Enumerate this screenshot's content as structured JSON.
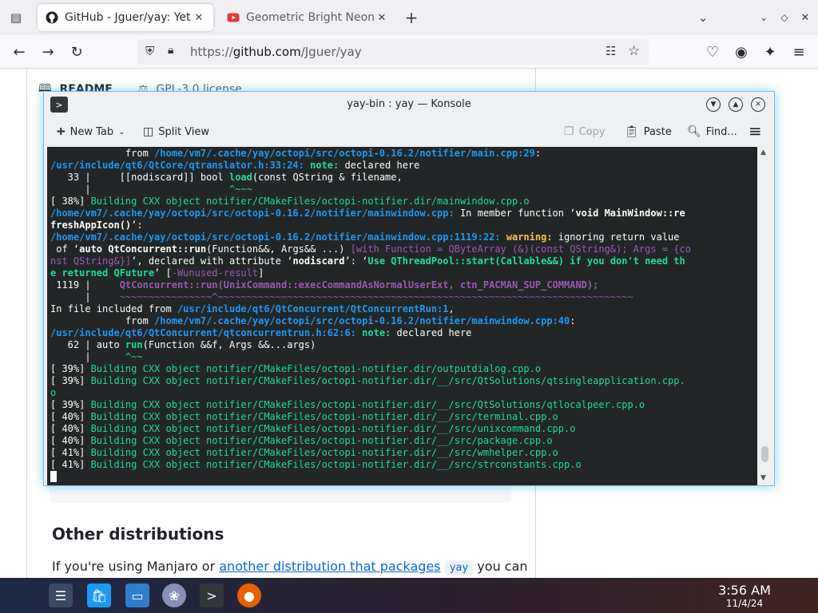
{
  "browser": {
    "tabs": [
      {
        "title": "GitHub - Jguer/yay: Yet an",
        "active": true
      },
      {
        "title": "Geometric Bright Neon Tr",
        "active": false
      }
    ],
    "url_scheme": "https://",
    "url_host": "github.com",
    "url_path": "/Jguer/yay"
  },
  "page": {
    "readme_tab": "README",
    "license_tab": "GPL-3.0 license",
    "heading": "Other distributions",
    "paragraph_start": "If you're using Manjaro or ",
    "paragraph_link": "another distribution that packages",
    "paragraph_code": "yay",
    "paragraph_end": " you can"
  },
  "konsole": {
    "title": "yay-bin : yay — Konsole",
    "toolbar": {
      "new_tab": "New Tab",
      "split_view": "Split View",
      "copy": "Copy",
      "paste": "Paste",
      "find": "Find..."
    },
    "scroll_position": 0.97,
    "scroll_visible_fraction": 0.05,
    "lines": [
      [
        [
          "",
          "             from "
        ],
        [
          "c-path",
          "/home/vm7/.cache/yay/octopi/src/octopi-0.16.2/notifier/main.cpp:29"
        ],
        [
          "",
          ":"
        ]
      ],
      [
        [
          "c-path",
          "/usr/include/qt6/QtCore/qtranslator.h:33:24: "
        ],
        [
          "c-gbold",
          "note:"
        ],
        [
          "",
          " declared here"
        ]
      ],
      [
        [
          "",
          "   33 |     [[nodiscard]] bool "
        ],
        [
          "c-gbold",
          "load"
        ],
        [
          "",
          "(const QString & filename,"
        ]
      ],
      [
        [
          "",
          "      |                        "
        ],
        [
          "c-green",
          "^~~~"
        ]
      ],
      [
        [
          "",
          "[ 38%] "
        ],
        [
          "c-green",
          "Building CXX object notifier/CMakeFiles/octopi-notifier.dir/mainwindow.cpp.o"
        ]
      ],
      [
        [
          "c-path",
          "/home/vm7/.cache/yay/octopi/src/octopi-0.16.2/notifier/mainwindow.cpp:"
        ],
        [
          "",
          " In member function ‘"
        ],
        [
          "c-bold",
          "void MainWindow::re"
        ]
      ],
      [
        [
          "c-bold",
          "freshAppIcon()"
        ],
        [
          "",
          "’:"
        ]
      ],
      [
        [
          "c-path",
          "/home/vm7/.cache/yay/octopi/src/octopi-0.16.2/notifier/mainwindow.cpp:1119:22: "
        ],
        [
          "c-warn",
          "warning: "
        ],
        [
          "",
          "ignoring return value"
        ]
      ],
      [
        [
          "",
          " of ‘"
        ],
        [
          "c-bold",
          "auto QtConcurrent::run"
        ],
        [
          "",
          "(Function&&, Args&& ...) "
        ],
        [
          "c-mag",
          "[with Function = QByteArray (&)(const QString&); Args = {co"
        ]
      ],
      [
        [
          "c-mag",
          "nst QString&}]"
        ],
        [
          "",
          "’, declared with attribute ‘"
        ],
        [
          "c-bold",
          "nodiscard"
        ],
        [
          "",
          "’: ‘"
        ],
        [
          "c-gbold",
          "Use QThreadPool::start(Callable&&) if you don't need th"
        ]
      ],
      [
        [
          "c-gbold",
          "e returned QFuture"
        ],
        [
          "",
          "’ ["
        ],
        [
          "c-mag",
          "-Wunused-result"
        ],
        [
          "",
          "]"
        ]
      ],
      [
        [
          "",
          " 1119 |     "
        ],
        [
          "c-magb",
          "QtConcurrent::run(UnixCommand::execCommandAsNormalUserExt, ctn_PACMAN_SUP_COMMAND);"
        ]
      ],
      [
        [
          "",
          "      |     "
        ],
        [
          "c-mag",
          "~~~~~~~~~~~~~~~~^~~~~~~~~~~~~~~~~~~~~~~~~~~~~~~~~~~~~~~~~~~~~~~~~~~~~~~~~~~~~~~~~~~~~~~~~"
        ]
      ],
      [
        [
          "",
          "In file included from "
        ],
        [
          "c-path",
          "/usr/include/qt6/QtConcurrent/QtConcurrentRun:1"
        ],
        [
          "",
          ","
        ]
      ],
      [
        [
          "",
          "             from "
        ],
        [
          "c-path",
          "/home/vm7/.cache/yay/octopi/src/octopi-0.16.2/notifier/mainwindow.cpp:40"
        ],
        [
          "",
          ":"
        ]
      ],
      [
        [
          "c-path",
          "/usr/include/qt6/QtConcurrent/qtconcurrentrun.h:62:6: "
        ],
        [
          "c-gbold",
          "note:"
        ],
        [
          "",
          " declared here"
        ]
      ],
      [
        [
          "",
          "   62 | auto "
        ],
        [
          "c-gbold",
          "run"
        ],
        [
          "",
          "(Function &&f, Args &&...args)"
        ]
      ],
      [
        [
          "",
          "      |      "
        ],
        [
          "c-green",
          "^~~"
        ]
      ],
      [
        [
          "",
          "[ 39%] "
        ],
        [
          "c-green",
          "Building CXX object notifier/CMakeFiles/octopi-notifier.dir/outputdialog.cpp.o"
        ]
      ],
      [
        [
          "",
          "[ 39%] "
        ],
        [
          "c-green",
          "Building CXX object notifier/CMakeFiles/octopi-notifier.dir/__/src/QtSolutions/qtsingleapplication.cpp."
        ]
      ],
      [
        [
          "c-green",
          "o"
        ]
      ],
      [
        [
          "",
          "[ 39%] "
        ],
        [
          "c-green",
          "Building CXX object notifier/CMakeFiles/octopi-notifier.dir/__/src/QtSolutions/qtlocalpeer.cpp.o"
        ]
      ],
      [
        [
          "",
          "[ 40%] "
        ],
        [
          "c-green",
          "Building CXX object notifier/CMakeFiles/octopi-notifier.dir/__/src/terminal.cpp.o"
        ]
      ],
      [
        [
          "",
          "[ 40%] "
        ],
        [
          "c-green",
          "Building CXX object notifier/CMakeFiles/octopi-notifier.dir/__/src/unixcommand.cpp.o"
        ]
      ],
      [
        [
          "",
          "[ 40%] "
        ],
        [
          "c-green",
          "Building CXX object notifier/CMakeFiles/octopi-notifier.dir/__/src/package.cpp.o"
        ]
      ],
      [
        [
          "",
          "[ 41%] "
        ],
        [
          "c-green",
          "Building CXX object notifier/CMakeFiles/octopi-notifier.dir/__/src/wmhelper.cpp.o"
        ]
      ],
      [
        [
          "",
          "[ 41%] "
        ],
        [
          "c-green",
          "Building CXX object notifier/CMakeFiles/octopi-notifier.dir/__/src/strconstants.cpp.o"
        ]
      ]
    ]
  },
  "taskbar": {
    "time": "3:56 AM",
    "date": "11/4/24"
  }
}
